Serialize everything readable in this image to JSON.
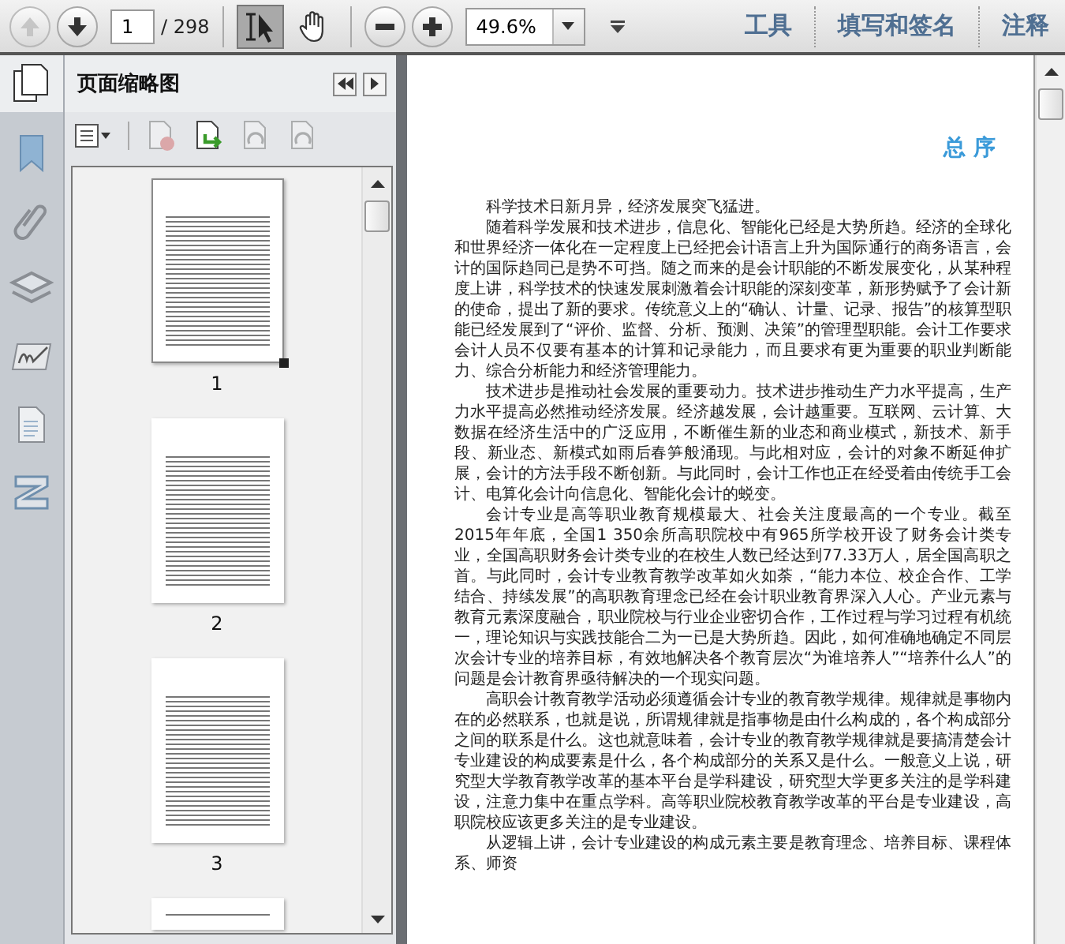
{
  "toolbar": {
    "nav_buttons": [
      {
        "kind": "prev",
        "disabled": true
      },
      {
        "kind": "next",
        "disabled": false
      }
    ],
    "page_field": "1",
    "page_total": "/ 298",
    "tools": [
      {
        "kind": "select",
        "selected": true
      },
      {
        "kind": "hand",
        "selected": false
      }
    ],
    "zoom_field": "49.6%",
    "menu_links": [
      "工具",
      "填写和签名",
      "注释"
    ]
  },
  "side_strip": [
    {
      "kind": "pages",
      "selected": true
    },
    {
      "kind": "bookmarks",
      "selected": false
    },
    {
      "kind": "attachments",
      "selected": false
    },
    {
      "kind": "layers",
      "selected": false
    },
    {
      "kind": "signatures",
      "selected": false
    },
    {
      "kind": "content",
      "selected": false
    },
    {
      "kind": "model_tree",
      "selected": false
    }
  ],
  "sidebar": {
    "title": "页面缩略图",
    "actions": [
      {
        "kind": "options",
        "disabled": false
      },
      {
        "kind": "delete",
        "disabled": true
      },
      {
        "kind": "insert",
        "disabled": false
      },
      {
        "kind": "rotate_ccw",
        "disabled": true
      },
      {
        "kind": "rotate_cw",
        "disabled": true
      }
    ],
    "thumbnails": [
      {
        "label": "1",
        "selected": true
      },
      {
        "label": "2",
        "selected": false
      },
      {
        "label": "3",
        "selected": false
      }
    ]
  },
  "document": {
    "heading": "总 序",
    "paragraphs": [
      "科学技术日新月异，经济发展突飞猛进。",
      "随着科学发展和技术进步，信息化、智能化已经是大势所趋。经济的全球化和世界经济一体化在一定程度上已经把会计语言上升为国际通行的商务语言，会计的国际趋同已是势不可挡。随之而来的是会计职能的不断发展变化，从某种程度上讲，科学技术的快速发展刺激着会计职能的深刻变革，新形势赋予了会计新的使命，提出了新的要求。传统意义上的“确认、计量、记录、报告”的核算型职能已经发展到了“评价、监督、分析、预测、决策”的管理型职能。会计工作要求会计人员不仅要有基本的计算和记录能力，而且要求有更为重要的职业判断能力、综合分析能力和经济管理能力。",
      "技术进步是推动社会发展的重要动力。技术进步推动生产力水平提高，生产力水平提高必然推动经济发展。经济越发展，会计越重要。互联网、云计算、大数据在经济生活中的广泛应用，不断催生新的业态和商业模式，新技术、新手段、新业态、新模式如雨后春笋般涌现。与此相对应，会计的对象不断延伸扩展，会计的方法手段不断创新。与此同时，会计工作也正在经受着由传统手工会计、电算化会计向信息化、智能化会计的蜕变。",
      "会计专业是高等职业教育规模最大、社会关注度最高的一个专业。截至2015年年底，全国1 350余所高职院校中有965所学校开设了财务会计类专业，全国高职财务会计类专业的在校生人数已经达到77.33万人，居全国高职之首。与此同时，会计专业教育教学改革如火如荼，“能力本位、校企合作、工学结合、持续发展”的高职教育理念已经在会计职业教育界深入人心。产业元素与教育元素深度融合，职业院校与行业企业密切合作，工作过程与学习过程有机统一，理论知识与实践技能合二为一已是大势所趋。因此，如何准确地确定不同层次会计专业的培养目标，有效地解决各个教育层次“为谁培养人”“培养什么人”的问题是会计教育界亟待解决的一个现实问题。",
      "高职会计教育教学活动必须遵循会计专业的教育教学规律。规律就是事物内在的必然联系，也就是说，所谓规律就是指事物是由什么构成的，各个构成部分之间的联系是什么。这也就意味着，会计专业的教育教学规律就是要搞清楚会计专业建设的构成要素是什么，各个构成部分的关系又是什么。一般意义上说，研究型大学教育教学改革的基本平台是学科建设，研究型大学更多关注的是学科建设，注意力集中在重点学科。高等职业院校教育教学改革的平台是专业建设，高职院校应该更多关注的是专业建设。",
      "从逻辑上讲，会计专业建设的构成元素主要是教育理念、培养目标、课程体系、师资"
    ]
  }
}
